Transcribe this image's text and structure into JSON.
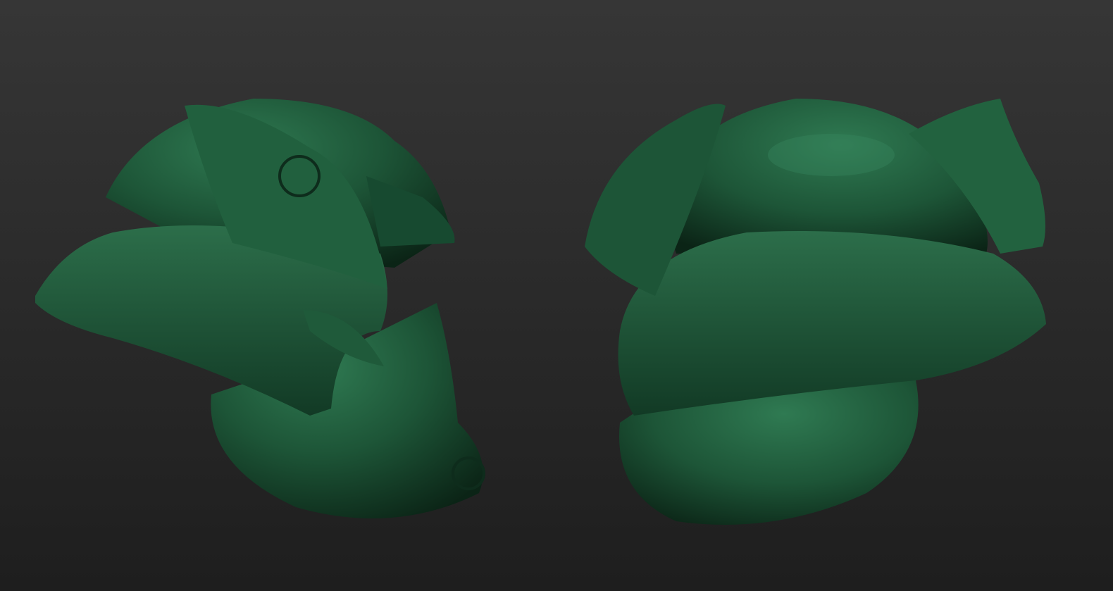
{
  "scene": {
    "background_top": "#363636",
    "background_bottom": "#1e1e1e",
    "mesh_light": "#2f7a52",
    "mesh_mid": "#1d5537",
    "mesh_dark": "#0b2416",
    "objects": [
      {
        "name": "samurai-helmet-left",
        "view": "side-left"
      },
      {
        "name": "samurai-helmet-right",
        "view": "back-right"
      }
    ]
  }
}
